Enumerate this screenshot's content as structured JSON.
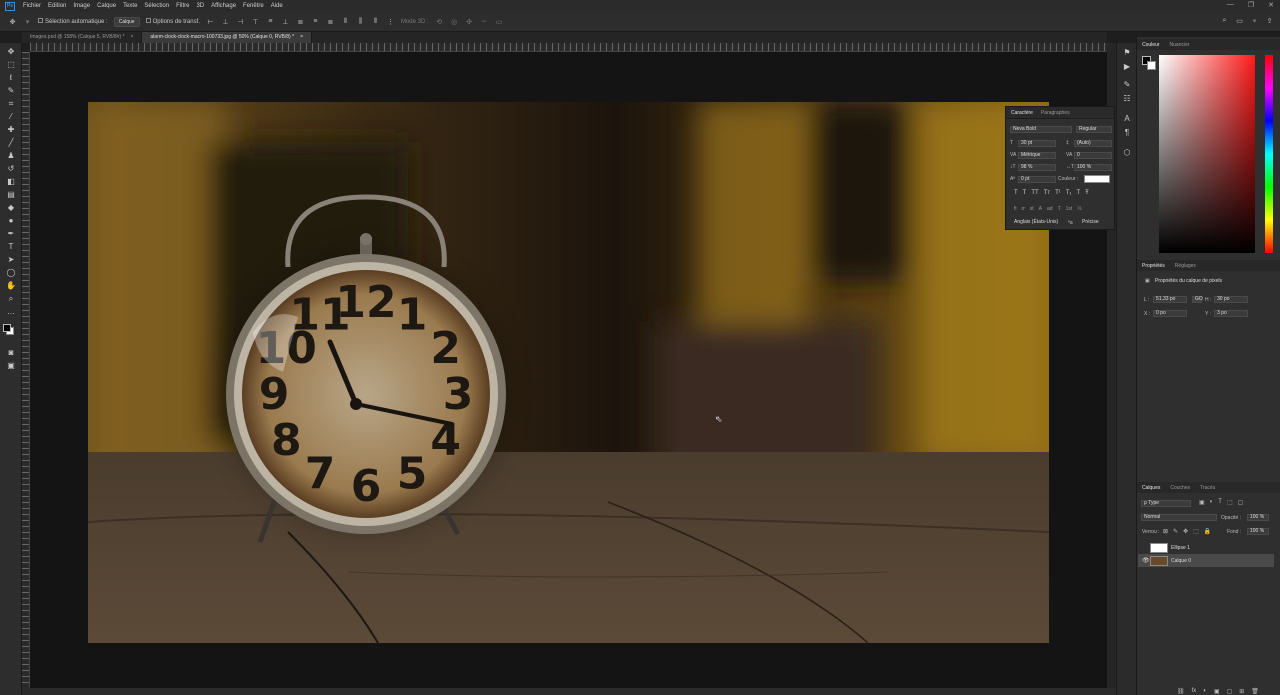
{
  "menu": [
    "Fichier",
    "Edition",
    "Image",
    "Calque",
    "Texte",
    "Sélection",
    "Filtre",
    "3D",
    "Affichage",
    "Fenêtre",
    "Aide"
  ],
  "window_controls": [
    "—",
    "❐",
    "✕"
  ],
  "options": {
    "auto_select": "Sélection automatique :",
    "layer_select": "Calque",
    "transform": "Options de transf.",
    "mode3d": "Mode 3D :"
  },
  "tabs": [
    {
      "label": "Images.psd @ 158% (Calque 5, RVB/8#) *",
      "close": "×"
    },
    {
      "label": "alarm-clock-clock-macro-100733.jpg @ 50% (Calque 0, RVB/8) *",
      "close": "×"
    }
  ],
  "character": {
    "tabs": [
      "Caractère",
      "Paragraphes"
    ],
    "font": "Neva Bold",
    "style": "Regular",
    "size": "30 pt",
    "leading": "(Auto)",
    "kerning": "Métrique",
    "tracking": "0",
    "vscale": "98 %",
    "hscale": "100 %",
    "baseline": "0 pt",
    "color_label": "Couleur :",
    "language": "Anglais (États-Unis)",
    "aa": "Précise",
    "aa_icon": "ªa",
    "glyph_row1": [
      "T",
      "T",
      "TT",
      "Tт",
      "T¹",
      "T₁",
      "T",
      "Ŧ"
    ],
    "glyph_row2": [
      "fi",
      "ơ",
      "st",
      "A",
      "ad",
      "T",
      "1st",
      "½"
    ]
  },
  "color_panel": {
    "tabs": [
      "Couleur",
      "Nuancier"
    ]
  },
  "properties": {
    "tabs": [
      "Propriétés",
      "Réglages"
    ],
    "title": "Propriétés du calque de pixels",
    "l_label": "L :",
    "l_value": "51,33 po",
    "link": "GO",
    "h_label": "H :",
    "h_value": "30 po",
    "x_label": "X :",
    "x_value": "0 po",
    "y_label": "Y :",
    "y_value": "3 po"
  },
  "layers": {
    "tabs": [
      "Calques",
      "Couches",
      "Tracés"
    ],
    "filter": "ρ Type",
    "blend": "Normal",
    "opacity_label": "Opacité :",
    "opacity": "100 %",
    "lock_label": "Verrou :",
    "fill_label": "Fond :",
    "fill": "100 %",
    "items": [
      {
        "name": "Ellipse 1",
        "visible": false
      },
      {
        "name": "Calque 0",
        "visible": true
      }
    ],
    "footer": [
      "⛓",
      "fx",
      "◐",
      "▣",
      "▢",
      "⊞",
      "🗑"
    ]
  },
  "canvas_bg": "#141414",
  "accent": "#3a8fd9",
  "tools": [
    "move-icon",
    "marquee-icon",
    "lasso-icon",
    "quick-select-icon",
    "crop-icon",
    "eyedropper-icon",
    "healing-icon",
    "brush-icon",
    "stamp-icon",
    "history-brush-icon",
    "eraser-icon",
    "gradient-icon",
    "blur-icon",
    "dodge-icon",
    "pen-icon",
    "type-icon",
    "path-select-icon",
    "shape-icon",
    "hand-icon",
    "zoom-icon",
    "more-icon"
  ],
  "clock_numbers": [
    "12",
    "1",
    "2",
    "3",
    "4",
    "5",
    "6",
    "7",
    "8",
    "9",
    "10",
    "11"
  ]
}
